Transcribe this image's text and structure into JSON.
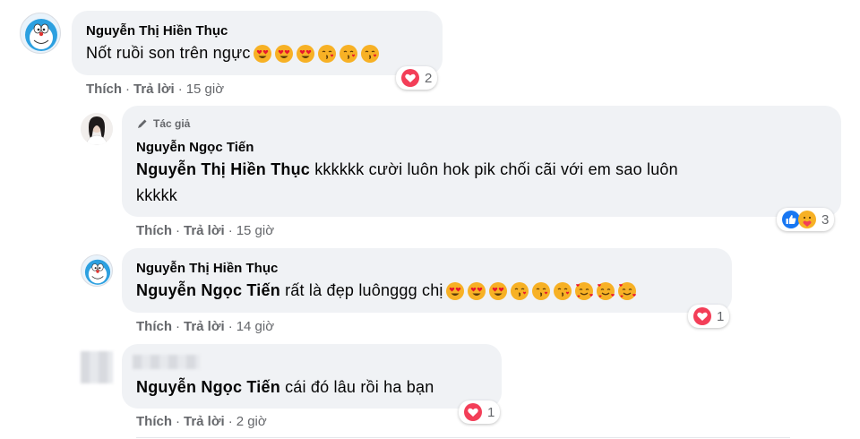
{
  "comments": [
    {
      "author": "Nguyễn Thị Hiền Thục",
      "text": "Nốt ruồi son trên ngực",
      "emojis": [
        "heart-eyes",
        "heart-eyes",
        "heart-eyes",
        "kissing",
        "kissing",
        "kissing"
      ],
      "actions": {
        "like": "Thích",
        "reply": "Trả lời",
        "time": "15 giờ"
      },
      "reaction": {
        "types": [
          "love"
        ],
        "count": "2"
      }
    },
    {
      "author_tag": "Tác giả",
      "author": "Nguyễn Ngọc Tiến",
      "mention": "Nguyễn Thị Hiền Thục",
      "text_line1": "kkkkkk cười luôn hok pik chối cãi với em sao luôn",
      "text_line2": "kkkkk",
      "actions": {
        "like": "Thích",
        "reply": "Trả lời",
        "time": "15 giờ"
      },
      "reaction": {
        "types": [
          "like",
          "care"
        ],
        "count": "3"
      }
    },
    {
      "author": "Nguyễn Thị Hiền Thục",
      "mention": "Nguyễn Ngọc Tiến",
      "text": "rất là đẹp luônggg chị",
      "emojis": [
        "heart-eyes",
        "heart-eyes",
        "heart-eyes",
        "kissing",
        "kissing",
        "kissing",
        "smiling-hearts",
        "smiling-hearts",
        "smiling-hearts"
      ],
      "actions": {
        "like": "Thích",
        "reply": "Trả lời",
        "time": "14 giờ"
      },
      "reaction": {
        "types": [
          "love"
        ],
        "count": "1"
      }
    },
    {
      "author": "",
      "mention": "Nguyễn Ngọc Tiến",
      "text": "cái đó lâu rồi ha bạn",
      "actions": {
        "like": "Thích",
        "reply": "Trả lời",
        "time": "2 giờ"
      },
      "reaction": {
        "types": [
          "love"
        ],
        "count": "1"
      }
    }
  ],
  "colors": {
    "bubble": "#f0f2f5",
    "meta": "#65676b",
    "like": "#1877f2",
    "love": "#f33e58"
  }
}
